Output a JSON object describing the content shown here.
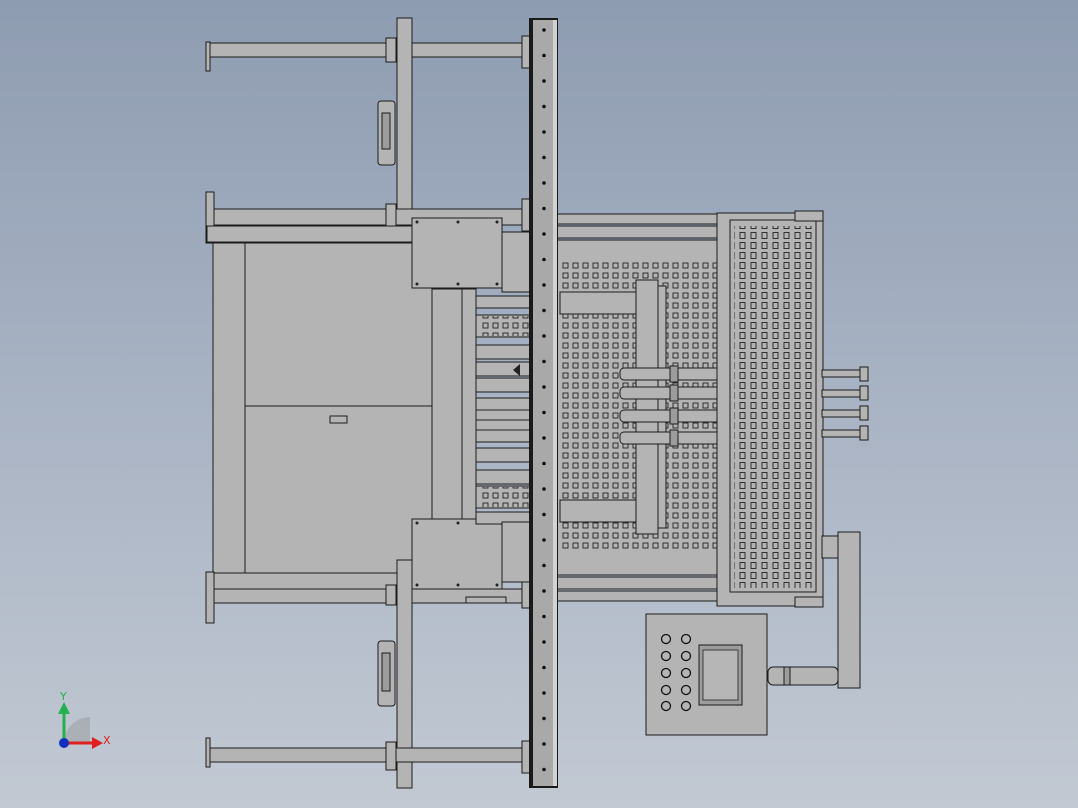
{
  "view": {
    "background_top": "#8e9cb1",
    "background_bottom": "#c2c9d3",
    "part_color": "#b4b4b4",
    "edge_color": "#1b1b1b"
  },
  "triad": {
    "y_label": "Y",
    "x_label": "X",
    "y_color": "#22b14c",
    "x_color": "#e02020",
    "origin_color": "#1030c0"
  },
  "control_panel": {
    "button_count": 10,
    "screen_count": 1
  }
}
